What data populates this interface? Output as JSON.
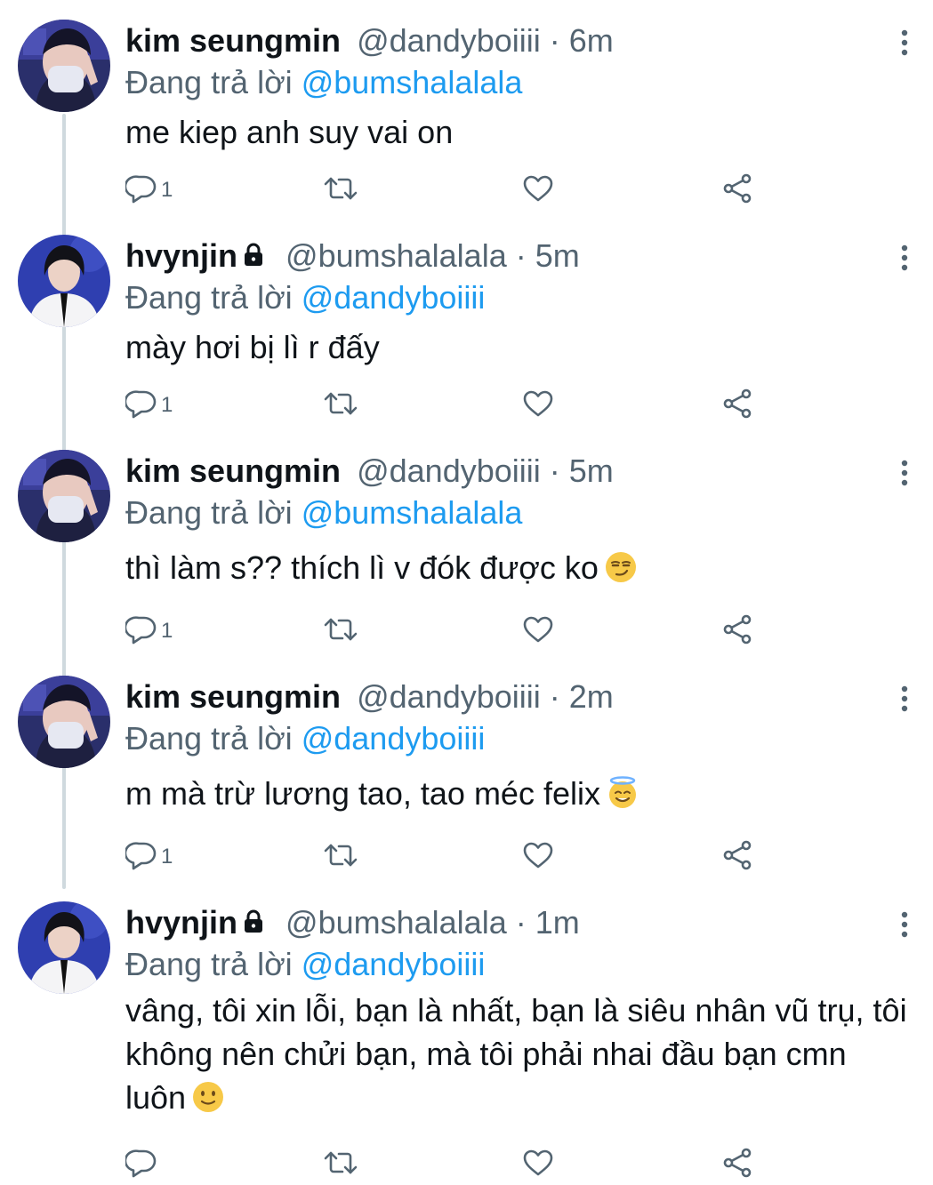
{
  "colors": {
    "name": "#0f1419",
    "secondary": "#536471",
    "accent": "#1d9bf0",
    "thread_line": "#cfd9de"
  },
  "tweets": [
    {
      "display_name": "kim seungmin",
      "locked": false,
      "handle": "@dandyboiiii",
      "time": "· 6m",
      "reply_prefix": "Đang trả lời",
      "reply_to": "@bumshalalala",
      "text": "me kiep anh suy vai on",
      "emoji": "",
      "reply_count": "1",
      "avatar": "seungmin-avatar"
    },
    {
      "display_name": "hvynjin",
      "locked": true,
      "handle": "@bumshalalala",
      "time": "· 5m",
      "reply_prefix": "Đang trả lời",
      "reply_to": "@dandyboiiii",
      "text": "mày hơi bị lì r đấy",
      "emoji": "",
      "reply_count": "1",
      "avatar": "hyunjin-avatar"
    },
    {
      "display_name": "kim seungmin",
      "locked": false,
      "handle": "@dandyboiiii",
      "time": "· 5m",
      "reply_prefix": "Đang trả lời",
      "reply_to": "@bumshalalala",
      "text": "thì làm s?? thích lì v đók được ko",
      "emoji": "smirk",
      "reply_count": "1",
      "avatar": "seungmin-avatar"
    },
    {
      "display_name": "kim seungmin",
      "locked": false,
      "handle": "@dandyboiiii",
      "time": "· 2m",
      "reply_prefix": "Đang trả lời",
      "reply_to": "@dandyboiiii",
      "text": "m mà trừ lương tao, tao méc felix",
      "emoji": "halo",
      "reply_count": "1",
      "avatar": "seungmin-avatar"
    },
    {
      "display_name": "hvynjin",
      "locked": true,
      "handle": "@bumshalalala",
      "time": "· 1m",
      "reply_prefix": "Đang trả lời",
      "reply_to": "@dandyboiiii",
      "text": "vâng, tôi xin lỗi, bạn là nhất, bạn là siêu nhân vũ trụ, tôi không nên chửi bạn, mà tôi phải nhai đầu bạn cmn luôn",
      "emoji": "slight-smile",
      "reply_count": "",
      "avatar": "hyunjin-avatar"
    }
  ]
}
